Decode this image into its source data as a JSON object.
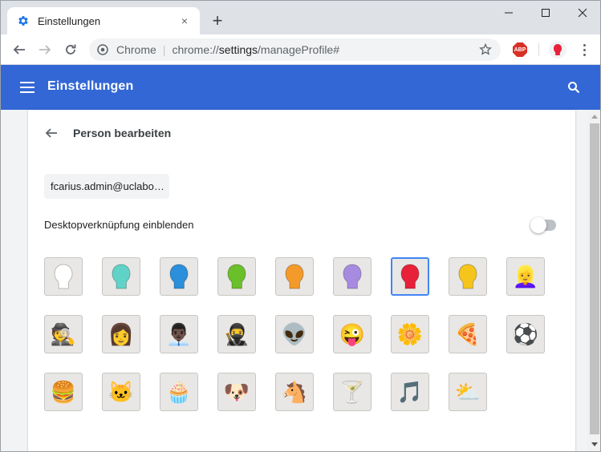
{
  "tab": {
    "title": "Einstellungen",
    "close_label": "×"
  },
  "new_tab_label": "+",
  "omnibox": {
    "origin": "Chrome",
    "separator": "|",
    "scheme": "chrome://",
    "host_path": "settings",
    "path": "/manageProfile#"
  },
  "extension": {
    "abp_label": "ABP"
  },
  "header": {
    "title": "Einstellungen"
  },
  "page": {
    "title": "Person bearbeiten",
    "name_value": "fcarius.admin@uclabo…",
    "shortcut_label": "Desktopverknüpfung einblenden",
    "shortcut_enabled": false
  },
  "colors": {
    "header_blue": "#3367d6",
    "selection_blue": "#4285f4",
    "avatar_bg": "#e8e7e5"
  },
  "avatars": [
    {
      "name": "avatar-white-head",
      "icon": "head",
      "color": "#ffffff",
      "selected": false
    },
    {
      "name": "avatar-cyan-head",
      "icon": "head",
      "color": "#5fd3c7",
      "selected": false
    },
    {
      "name": "avatar-blue-head",
      "icon": "head",
      "color": "#2b8fdb",
      "selected": false
    },
    {
      "name": "avatar-green-head",
      "icon": "head",
      "color": "#6bbf2b",
      "selected": false
    },
    {
      "name": "avatar-orange-head",
      "icon": "head",
      "color": "#f49a2a",
      "selected": false
    },
    {
      "name": "avatar-purple-head",
      "icon": "head",
      "color": "#a78be0",
      "selected": false
    },
    {
      "name": "avatar-red-head",
      "icon": "head",
      "color": "#e8213a",
      "selected": true
    },
    {
      "name": "avatar-yellow-head",
      "icon": "head",
      "color": "#f6c51c",
      "selected": false
    },
    {
      "name": "avatar-blonde-woman",
      "icon": "emoji",
      "glyph": "👱‍♀️",
      "selected": false
    },
    {
      "name": "avatar-spy",
      "icon": "emoji",
      "glyph": "🕵️",
      "selected": false
    },
    {
      "name": "avatar-woman-sunglasses",
      "icon": "emoji",
      "glyph": "👩",
      "selected": false
    },
    {
      "name": "avatar-businessman",
      "icon": "emoji",
      "glyph": "👨🏿‍💼",
      "selected": false
    },
    {
      "name": "avatar-ninja",
      "icon": "emoji",
      "glyph": "🥷",
      "selected": false
    },
    {
      "name": "avatar-alien",
      "icon": "emoji",
      "glyph": "👽",
      "selected": false
    },
    {
      "name": "avatar-smiley",
      "icon": "emoji",
      "glyph": "😜",
      "selected": false
    },
    {
      "name": "avatar-flower",
      "icon": "emoji",
      "glyph": "🌼",
      "selected": false
    },
    {
      "name": "avatar-pizza",
      "icon": "emoji",
      "glyph": "🍕",
      "selected": false
    },
    {
      "name": "avatar-soccer-ball",
      "icon": "emoji",
      "glyph": "⚽",
      "selected": false
    },
    {
      "name": "avatar-burger",
      "icon": "emoji",
      "glyph": "🍔",
      "selected": false
    },
    {
      "name": "avatar-cat",
      "icon": "emoji",
      "glyph": "🐱",
      "selected": false
    },
    {
      "name": "avatar-cupcake",
      "icon": "emoji",
      "glyph": "🧁",
      "selected": false
    },
    {
      "name": "avatar-dog",
      "icon": "emoji",
      "glyph": "🐶",
      "selected": false
    },
    {
      "name": "avatar-horse",
      "icon": "emoji",
      "glyph": "🐴",
      "selected": false
    },
    {
      "name": "avatar-cocktail",
      "icon": "emoji",
      "glyph": "🍸",
      "selected": false
    },
    {
      "name": "avatar-music-note",
      "icon": "emoji",
      "glyph": "🎵",
      "selected": false
    },
    {
      "name": "avatar-sun-cloud",
      "icon": "emoji",
      "glyph": "⛅",
      "selected": false
    }
  ]
}
